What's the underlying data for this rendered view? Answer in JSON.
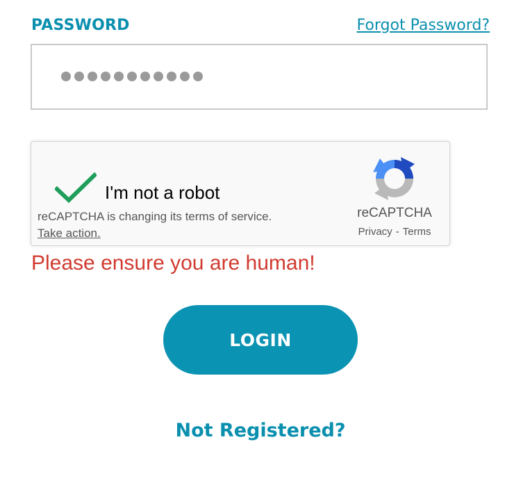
{
  "password": {
    "label": "PASSWORD",
    "forgot_link": "Forgot Password?",
    "masked_value": "●●●●●●●●●●●",
    "char_count": 11
  },
  "recaptcha": {
    "checkbox_label": "I'm not a robot",
    "checked": true,
    "notice": "reCAPTCHA is changing its terms of service.",
    "action_link": "Take action.",
    "brand": "reCAPTCHA",
    "privacy_link": "Privacy",
    "separator": "-",
    "terms_link": "Terms",
    "icons": {
      "check": "checkmark-icon",
      "logo": "recaptcha-logo-icon"
    }
  },
  "error": {
    "message": "Please ensure you are human!",
    "color": "#d03a2f"
  },
  "actions": {
    "login_label": "LOGIN",
    "not_registered": "Not Registered?"
  },
  "colors": {
    "accent": "#0a93b2",
    "link": "#0a8fae",
    "check": "#1e9e5a"
  }
}
